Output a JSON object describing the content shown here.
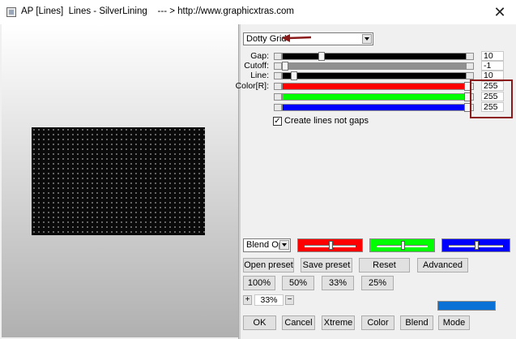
{
  "window": {
    "title": "AP [Lines]  Lines - SilverLining    --- > http://www.graphicxtras.com",
    "close_glyph": "✕"
  },
  "preset_combo": {
    "value": "Dotty Grid"
  },
  "sliders": [
    {
      "label": "Gap:",
      "value": "10",
      "fill": "#000000",
      "level": 0.2
    },
    {
      "label": "Cutoff:",
      "value": "-1",
      "fill": "#909090",
      "level": 0.0
    },
    {
      "label": "Line:",
      "value": "10",
      "fill": "#000000",
      "level": 0.05
    },
    {
      "label": "Color[R]:",
      "value": "255",
      "fill": "#ff0000",
      "level": 1.0
    },
    {
      "label": "",
      "value": "255",
      "fill": "#00ff00",
      "level": 1.0
    },
    {
      "label": "",
      "value": "255",
      "fill": "#0000ff",
      "level": 1.0
    }
  ],
  "checkbox": {
    "label": "Create lines not gaps",
    "checked": true
  },
  "blend_combo": {
    "value": "Blend Opti"
  },
  "color_swatches": [
    {
      "name": "red",
      "color": "#ff0000",
      "level": 0.5
    },
    {
      "name": "green",
      "color": "#00ff00",
      "level": 0.5
    },
    {
      "name": "blue",
      "color": "#0000ff",
      "level": 0.5
    }
  ],
  "buttons_row1": [
    "Open preset",
    "Save preset",
    "Reset",
    "Advanced"
  ],
  "zoom_buttons": [
    "100%",
    "50%",
    "33%",
    "25%"
  ],
  "zoom_stepper": {
    "plus": "+",
    "value": "33%",
    "minus": "−"
  },
  "bottom_buttons": [
    "OK",
    "Cancel",
    "Xtreme",
    "Color",
    "Blend",
    "Mode"
  ],
  "progress_color": "#0a72d6",
  "annotation_color": "#8b1a1a"
}
